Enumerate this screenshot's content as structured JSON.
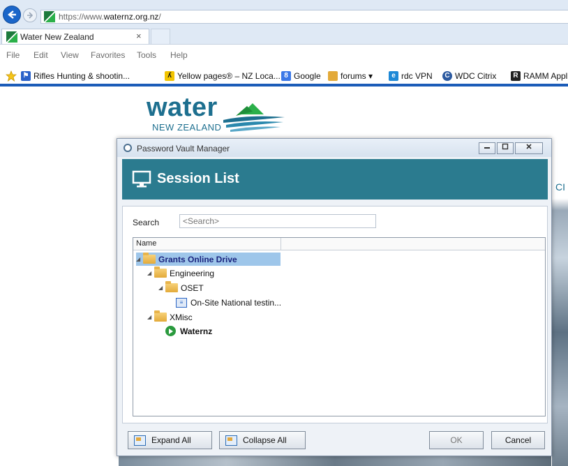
{
  "browser": {
    "url_prefix": "https://www.",
    "url_domain": "waternz.org.nz",
    "url_suffix": "/",
    "tab_title": "Water New Zealand",
    "tab_close": "×",
    "menu": [
      "File",
      "Edit",
      "View",
      "Favorites",
      "Tools",
      "Help"
    ],
    "favorites": [
      {
        "label": "Rifles Hunting & shootin...",
        "icon": "rifle-site-icon",
        "color": "#2a62c9"
      },
      {
        "label": "Yellow pages® – NZ Loca...",
        "icon": "yellow-pages-icon",
        "color": "#f2c400"
      },
      {
        "label": "Google",
        "icon": "google-icon",
        "color": "#3b78e7"
      },
      {
        "label": "forums ▾",
        "icon": "folder-icon",
        "color": "#e3aa3a"
      },
      {
        "label": "rdc VPN",
        "icon": "ie-icon",
        "color": "#1e88d6"
      },
      {
        "label": "WDC Citrix",
        "icon": "citrix-icon",
        "color": "#2c5aa0"
      },
      {
        "label": "RAMM Appl",
        "icon": "ramm-icon",
        "color": "#222222"
      }
    ]
  },
  "page": {
    "logo_word": "water",
    "logo_sub": "NEW ZEALAND",
    "right_text": "CI"
  },
  "dialog": {
    "title": "Password Vault Manager",
    "heading": "Session List",
    "search_label": "Search",
    "search_placeholder": "<Search>",
    "column_name": "Name",
    "tree": [
      {
        "label": "Grants Online Drive",
        "type": "folder",
        "level": 0,
        "selected": true
      },
      {
        "label": "Engineering",
        "type": "folder",
        "level": 1
      },
      {
        "label": "OSET",
        "type": "folder",
        "level": 2
      },
      {
        "label": "On-Site National testin...",
        "type": "vpn-entry",
        "level": 3
      },
      {
        "label": "XMisc",
        "type": "folder",
        "level": 1
      },
      {
        "label": "Waternz",
        "type": "web-entry",
        "level": 2
      }
    ],
    "buttons": {
      "expand_all": "Expand All",
      "collapse_all": "Collapse All",
      "ok": "OK",
      "cancel": "Cancel"
    },
    "colors": {
      "header": "#2b7b8f",
      "selection": "#9ec6ea",
      "accent_text": "#1a237e"
    }
  }
}
